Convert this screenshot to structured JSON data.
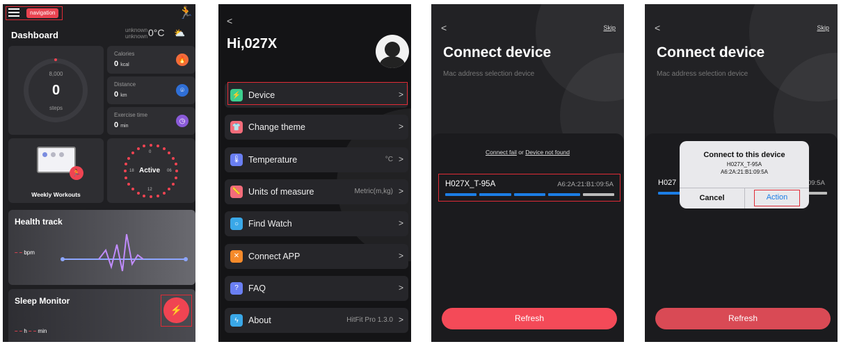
{
  "screen1": {
    "nav_badge": "navigation",
    "dashboard_title": "Dashboard",
    "weather_unknown_1": "unknown",
    "weather_unknown_2": "unknown",
    "temperature": "0°C",
    "steps_goal": "8,000",
    "steps_value": "0",
    "steps_label": "steps",
    "calories_label": "Calories",
    "calories_value": "0",
    "calories_unit": "kcal",
    "distance_label": "Distance",
    "distance_value": "0",
    "distance_unit": "km",
    "exercise_label": "Exercise time",
    "exercise_value": "0",
    "exercise_unit": "min",
    "weekly_workouts": "Weekly Workouts",
    "active_label": "Active",
    "clock_0": "0",
    "clock_06": "06",
    "clock_12": "12",
    "clock_18": "18",
    "health_track": "Health track",
    "bpm_dashes": "– –",
    "bpm_unit": "bpm",
    "sleep_monitor": "Sleep Monitor",
    "sleep_h_dashes": "– –",
    "sleep_h": "h",
    "sleep_min_dashes": "– –",
    "sleep_min": "min",
    "colors": {
      "accent": "#f04452",
      "calories": "#f26b3a",
      "distance": "#2f6fd6",
      "exercise": "#8a5ad8"
    }
  },
  "screen2": {
    "back": "<",
    "greeting": "Hi,027X",
    "menu": [
      {
        "label": "Device",
        "value": "",
        "icon": "device-icon",
        "color": "#3ccf8e"
      },
      {
        "label": "Change theme",
        "value": "",
        "icon": "shirt-icon",
        "color": "#f36c7a"
      },
      {
        "label": "Temperature",
        "value": "°C",
        "icon": "thermometer-icon",
        "color": "#6a7ff2"
      },
      {
        "label": "Units of measure",
        "value": "Metric(m,kg)",
        "icon": "ruler-icon",
        "color": "#f36c7a"
      },
      {
        "label": "Find Watch",
        "value": "",
        "icon": "search-icon",
        "color": "#3aa8e8"
      },
      {
        "label": "Connect APP",
        "value": "",
        "icon": "connect-icon",
        "color": "#f58a2a"
      },
      {
        "label": "FAQ",
        "value": "",
        "icon": "question-icon",
        "color": "#6a7ff2"
      },
      {
        "label": "About",
        "value": "HitFit Pro 1.3.0",
        "icon": "lightning-icon",
        "color": "#3aa8e8"
      }
    ],
    "chevron": ">"
  },
  "screen3": {
    "back": "<",
    "skip": "Skip",
    "title": "Connect device",
    "subtitle": "Mac address selection device",
    "connect_fail": "Connect fail",
    "or": "or",
    "device_not_found": "Device not found",
    "device_name": "H027X_T-95A",
    "device_mac": "A6:2A:21:B1:09:5A",
    "refresh": "Refresh"
  },
  "screen4": {
    "back": "<",
    "skip": "Skip",
    "title": "Connect device",
    "subtitle": "Mac address selection device",
    "device_name_partial": "H027",
    "device_mac_partial": "09:5A",
    "dialog_title": "Connect to this device",
    "dialog_device": "H027X_T-95A",
    "dialog_mac": "A6:2A:21:B1:09:5A",
    "cancel": "Cancel",
    "action": "Action",
    "refresh": "Refresh"
  }
}
